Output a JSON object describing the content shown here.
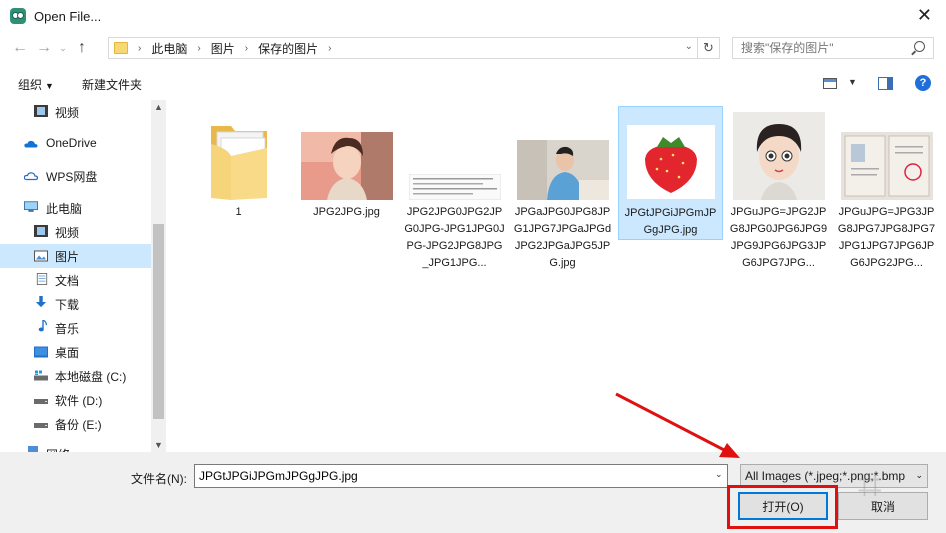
{
  "window": {
    "title": "Open File..."
  },
  "address": {
    "crumbs": [
      "此电脑",
      "图片",
      "保存的图片"
    ],
    "search_placeholder": "搜索\"保存的图片\""
  },
  "toolbar": {
    "organize": "组织",
    "new_folder": "新建文件夹"
  },
  "sidebar": {
    "items": [
      {
        "label": "视频",
        "icon": "video-icon"
      },
      {
        "label": "OneDrive",
        "icon": "cloud-icon"
      },
      {
        "label": "WPS网盘",
        "icon": "wps-cloud-icon"
      },
      {
        "label": "此电脑",
        "icon": "computer-icon"
      },
      {
        "label": "视频",
        "icon": "video-icon"
      },
      {
        "label": "图片",
        "icon": "pictures-icon"
      },
      {
        "label": "文档",
        "icon": "documents-icon"
      },
      {
        "label": "下载",
        "icon": "download-icon"
      },
      {
        "label": "音乐",
        "icon": "music-icon"
      },
      {
        "label": "桌面",
        "icon": "desktop-icon"
      },
      {
        "label": "本地磁盘 (C:)",
        "icon": "drive-icon"
      },
      {
        "label": "软件 (D:)",
        "icon": "drive-icon"
      },
      {
        "label": "备份 (E:)",
        "icon": "drive-icon"
      },
      {
        "label": "网络",
        "icon": "network-icon"
      }
    ],
    "selected_index": 5
  },
  "files": [
    {
      "name": "1",
      "kind": "folder"
    },
    {
      "name": "JPG2JPG.jpg",
      "kind": "image-anime"
    },
    {
      "name": "JPG2JPG0JPG2JPG0JPG-JPG1JPG0JPG-JPG2JPG8JPG_JPG1JPG...",
      "kind": "image-doc"
    },
    {
      "name": "JPGaJPG0JPG8JPG1JPG7JPGaJPGdJPG2JPGaJPG5JPG.jpg",
      "kind": "image-photo"
    },
    {
      "name": "JPGtJPGiJPGmJPGgJPG.jpg",
      "kind": "image-strawberry",
      "selected": true
    },
    {
      "name": "JPGuJPG=JPG2JPG8JPG0JPG6JPG9JPG9JPG6JPG3JPG6JPG7JPG...",
      "kind": "image-portrait"
    },
    {
      "name": "JPGuJPG=JPG3JPG8JPG7JPG8JPG7JPG1JPG7JPG6JPG6JPG2JPG...",
      "kind": "image-certificate"
    }
  ],
  "bottom": {
    "filename_label": "文件名(N):",
    "filename_value": "JPGtJPGiJPGmJPGgJPG.jpg",
    "filter_value": "All Images (*.jpeg;*.png;*.bmp",
    "open_label": "打开(O)",
    "cancel_label": "取消"
  },
  "colors": {
    "selection": "#cce8ff",
    "highlight": "#e01010",
    "accent": "#0078d7"
  }
}
